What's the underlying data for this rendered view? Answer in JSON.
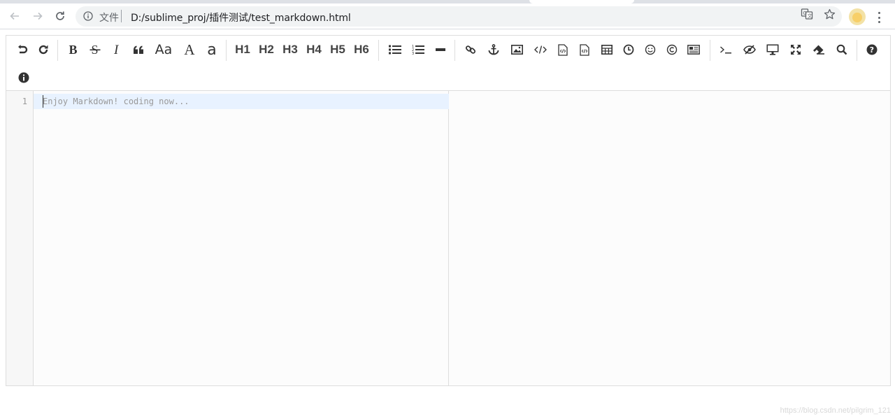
{
  "browser": {
    "scheme_label": "文件",
    "url": "D:/sublime_proj/插件测试/test_markdown.html",
    "icons": {
      "back": "arrow-left-icon",
      "forward": "arrow-right-icon",
      "reload": "reload-icon",
      "info": "info-circle-icon",
      "translate": "translate-icon",
      "bookmark": "star-icon",
      "profile": "avatar",
      "menu": "kebab-menu-icon"
    }
  },
  "toolbar": {
    "headings": [
      "H1",
      "H2",
      "H3",
      "H4",
      "H5",
      "H6"
    ],
    "font_size_label": "Aa",
    "uppercase_label": "A",
    "lowercase_label": "a"
  },
  "editor": {
    "line_number": "1",
    "placeholder": "Enjoy Markdown! coding now..."
  },
  "watermark": "https://blog.csdn.net/pilgrim_121"
}
